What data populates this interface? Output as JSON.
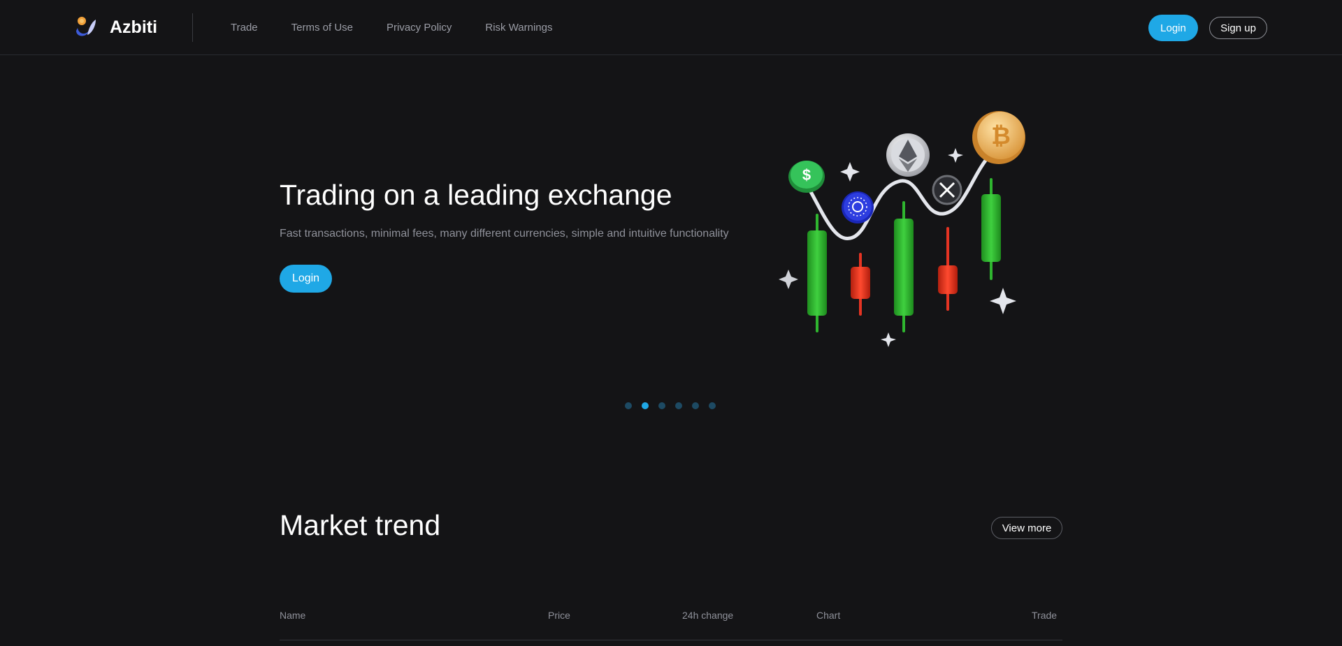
{
  "header": {
    "brand": "Azbiti",
    "nav": [
      "Trade",
      "Terms of Use",
      "Privacy Policy",
      "Risk Warnings"
    ],
    "login_label": "Login",
    "signup_label": "Sign up"
  },
  "hero": {
    "title": "Trading on a leading exchange",
    "subtitle": "Fast transactions, minimal fees, many different currencies, simple and intuitive functionality",
    "login_label": "Login",
    "illustration_icon": "crypto-candlestick-illustration"
  },
  "carousel": {
    "total": 6,
    "active_index": 2
  },
  "market": {
    "title": "Market trend",
    "view_more_label": "View more",
    "columns": [
      "Name",
      "Price",
      "24h change",
      "Chart",
      "Trade"
    ]
  },
  "colors": {
    "background": "#141416",
    "accent": "#1fa8e6",
    "muted_text": "#8f919a",
    "candle_green": "#2fb52f",
    "candle_red": "#e53423"
  }
}
